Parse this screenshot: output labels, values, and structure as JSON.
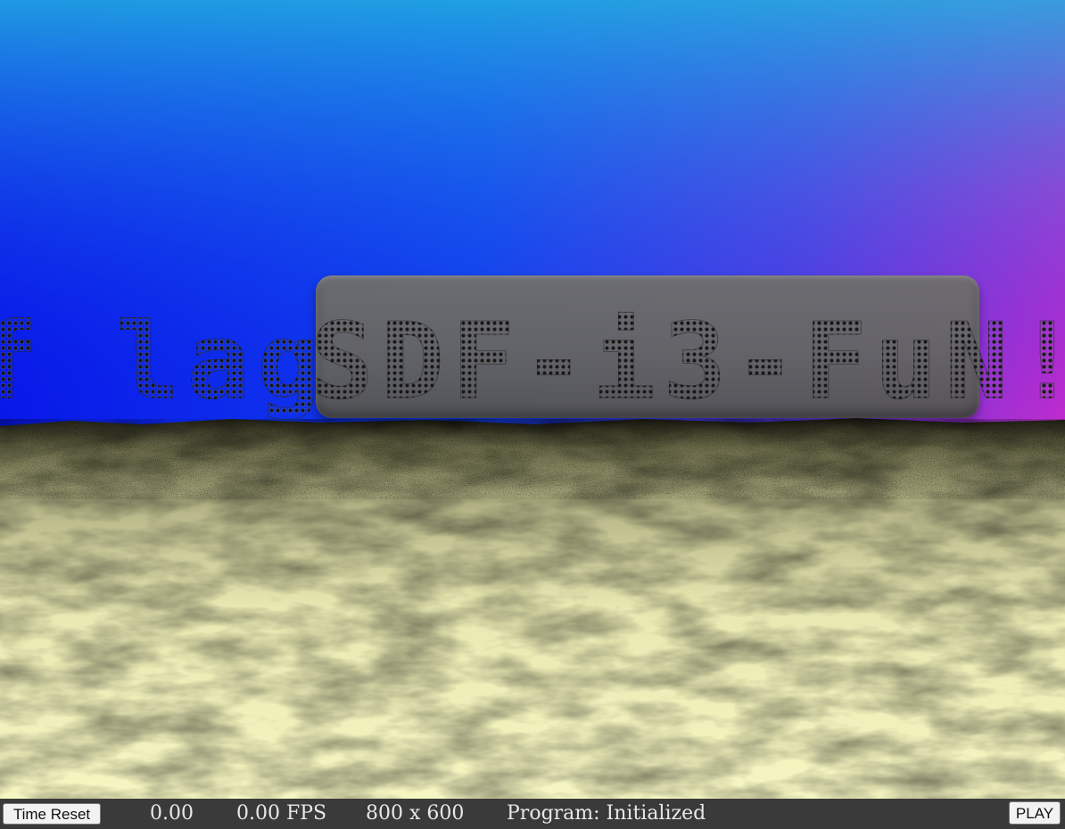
{
  "scene": {
    "flag_left_text": "f lag{",
    "flag_right_text": "SDF-i3-FuN!",
    "sky_colors": [
      "#0a1de6",
      "#1a5cf0",
      "#1e90e0",
      "#7b30d8",
      "#c430c8"
    ],
    "sand_colors": [
      "#f7f7c0",
      "#d8d8a0",
      "#8a8a62",
      "#2a2a1c"
    ]
  },
  "status_bar": {
    "time_reset_label": "Time Reset",
    "time_value": "0.00",
    "fps_value": "0.00 FPS",
    "resolution": "800 x 600",
    "program_status": "Program: Initialized",
    "play_label": "PLAY"
  }
}
